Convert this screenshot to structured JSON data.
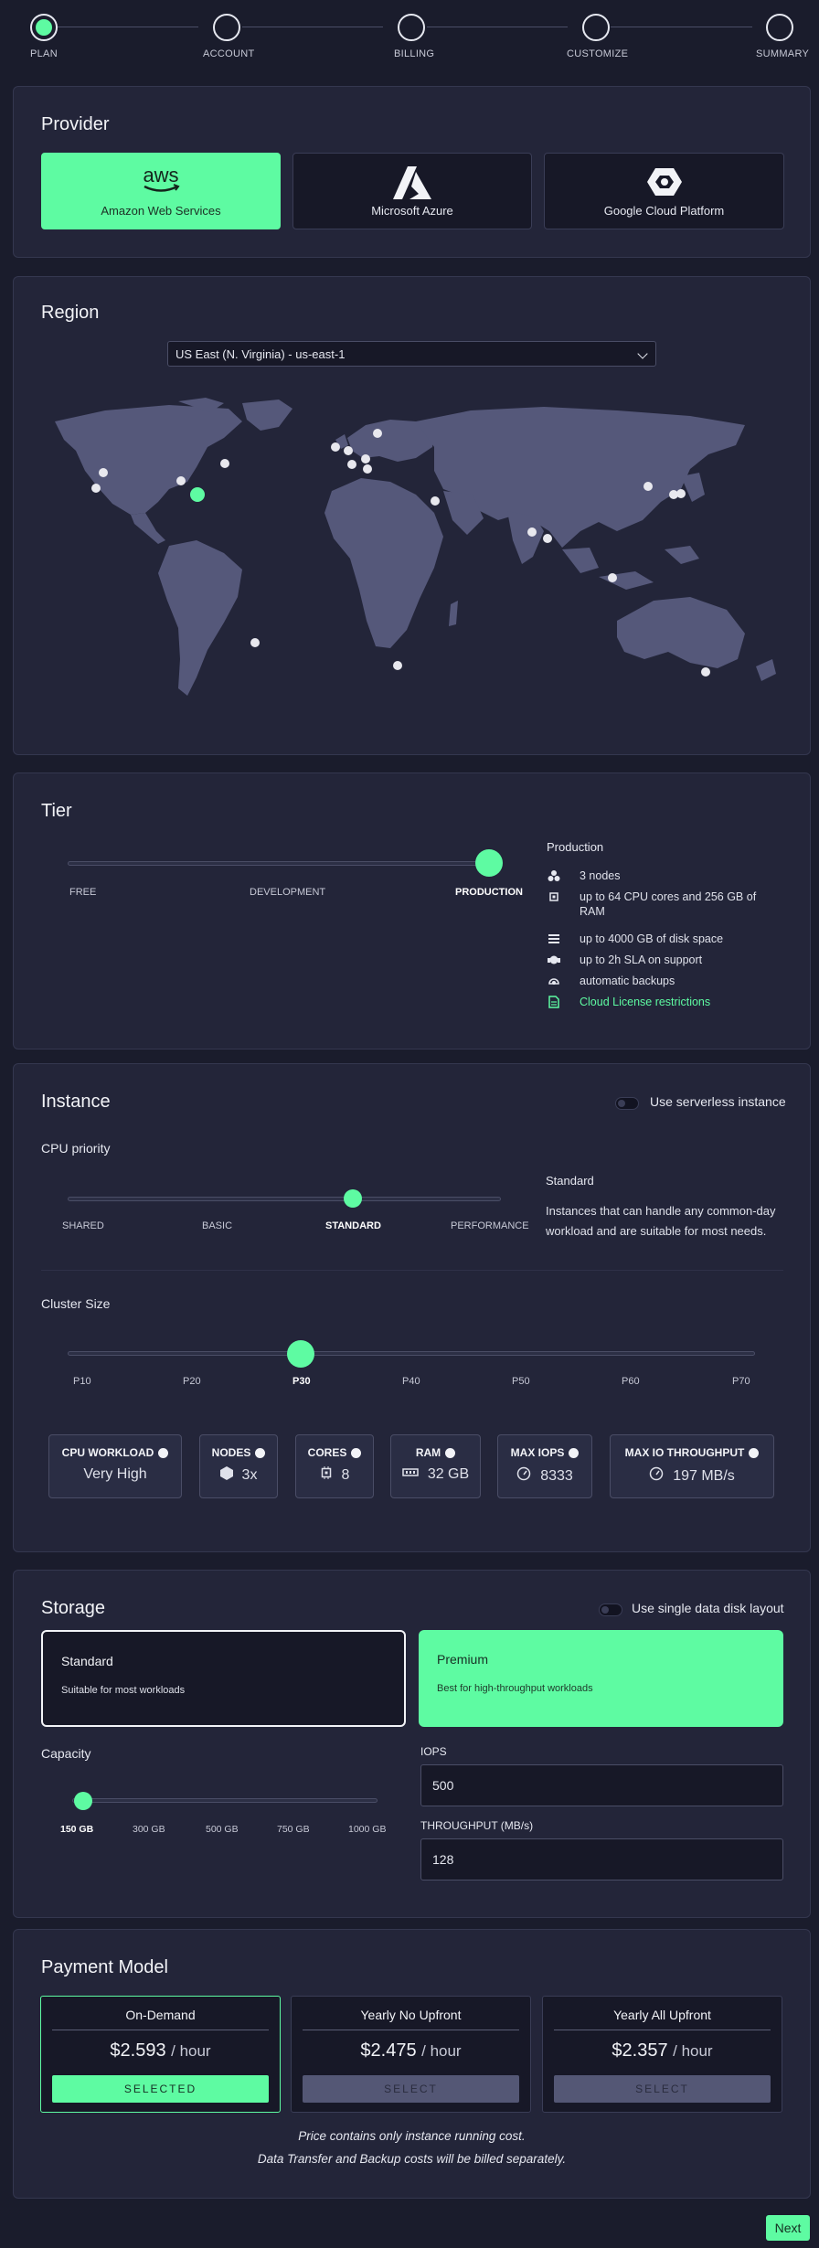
{
  "stepper": {
    "steps": [
      "PLAN",
      "ACCOUNT",
      "BILLING",
      "CUSTOMIZE",
      "SUMMARY"
    ],
    "active": 0
  },
  "provider": {
    "title": "Provider",
    "options": [
      {
        "name": "Amazon Web Services",
        "logo_text": "aws",
        "icon": "aws-logo-icon",
        "selected": true
      },
      {
        "name": "Microsoft Azure",
        "icon": "azure-logo-icon",
        "selected": false
      },
      {
        "name": "Google Cloud Platform",
        "icon": "gcp-logo-icon",
        "selected": false
      }
    ]
  },
  "region": {
    "title": "Region",
    "selected": "US East (N. Virginia) - us-east-1"
  },
  "tier": {
    "title": "Tier",
    "levels": [
      "FREE",
      "DEVELOPMENT",
      "PRODUCTION"
    ],
    "selected_index": 2,
    "details_title": "Production",
    "details": [
      {
        "icon": "nodes-icon",
        "text": "3 nodes"
      },
      {
        "icon": "cpu-icon",
        "text": "up to 64 CPU cores and 256 GB of RAM"
      },
      {
        "icon": "disk-icon",
        "text": "up to 4000 GB of disk space"
      },
      {
        "icon": "support-icon",
        "text": "up to 2h SLA on support"
      },
      {
        "icon": "backup-icon",
        "text": "automatic backups"
      },
      {
        "icon": "document-icon",
        "text": "Cloud License restrictions",
        "link": true
      }
    ]
  },
  "instance": {
    "title": "Instance",
    "serverless_label": "Use serverless instance",
    "cpu_priority_label": "CPU priority",
    "cpu_levels": [
      "SHARED",
      "BASIC",
      "STANDARD",
      "PERFORMANCE"
    ],
    "cpu_selected_index": 2,
    "cpu_desc_title": "Standard",
    "cpu_desc": "Instances that can handle any common-day workload and are suitable for most needs.",
    "cluster_label": "Cluster Size",
    "cluster_sizes": [
      "P10",
      "P20",
      "P30",
      "P40",
      "P50",
      "P60",
      "P70"
    ],
    "cluster_selected_index": 2,
    "stats": [
      {
        "label": "CPU WORKLOAD",
        "value": "Very High",
        "icon": ""
      },
      {
        "label": "NODES",
        "value": "3x",
        "icon": "nodes-hex-icon"
      },
      {
        "label": "CORES",
        "value": "8",
        "icon": "cpu-icon"
      },
      {
        "label": "RAM",
        "value": "32 GB",
        "icon": "ram-icon"
      },
      {
        "label": "MAX IOPS",
        "value": "8333",
        "icon": "gauge-icon"
      },
      {
        "label": "MAX IO THROUGHPUT",
        "value": "197 MB/s",
        "icon": "gauge-icon"
      }
    ]
  },
  "storage": {
    "title": "Storage",
    "single_disk_label": "Use single data disk layout",
    "types": [
      {
        "name": "Standard",
        "desc": "Suitable for most workloads",
        "selected": false
      },
      {
        "name": "Premium",
        "desc": "Best for high-throughput workloads",
        "selected": true
      }
    ],
    "capacity_label": "Capacity",
    "capacity_options": [
      "150 GB",
      "300 GB",
      "500 GB",
      "750 GB",
      "1000 GB"
    ],
    "capacity_selected_index": 0,
    "iops_label": "IOPS",
    "iops_value": "500",
    "throughput_label": "THROUGHPUT (MB/s)",
    "throughput_value": "128"
  },
  "payment": {
    "title": "Payment Model",
    "options": [
      {
        "name": "On-Demand",
        "price": "$2.593",
        "unit": "/ hour",
        "button": "SELECTED",
        "selected": true
      },
      {
        "name": "Yearly No Upfront",
        "price": "$2.475",
        "unit": "/ hour",
        "button": "SELECT",
        "selected": false
      },
      {
        "name": "Yearly All Upfront",
        "price": "$2.357",
        "unit": "/ hour",
        "button": "SELECT",
        "selected": false
      }
    ],
    "note_line1": "Price contains only instance running cost.",
    "note_line2": "Data Transfer and Backup costs will be billed separately."
  },
  "next_label": "Next",
  "colors": {
    "accent": "#5efba2",
    "background": "#1a1c2c",
    "card": "#232539"
  }
}
